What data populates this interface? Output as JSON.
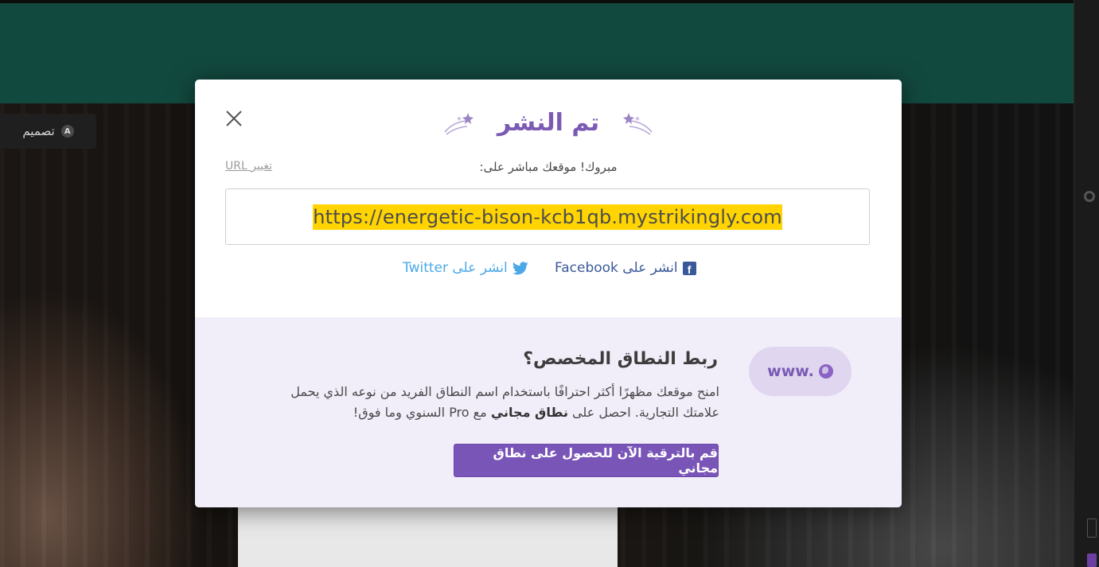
{
  "editor": {
    "design_label": "تصميم",
    "design_badge": "A"
  },
  "modal": {
    "title": "تم النشر",
    "subtitle": "مبروك! موقعك مباشر على:",
    "change_url_label": "تغيير URL",
    "site_url": "https://energetic-bison-kcb1qb.mystrikingly.com",
    "share_facebook": "انشر على Facebook",
    "share_twitter": "انشر على Twitter"
  },
  "promo": {
    "www_label": "www.",
    "title": "ربط النطاق المخصص؟",
    "desc_part1": "امنح موقعك مظهرًا أكثر احترافًا باستخدام اسم النطاق الفريد من نوعه الذي يحمل علامتك التجارية. احصل على ",
    "desc_bold": "نطاق مجاني",
    "desc_part2": " مع Pro السنوي وما فوق!",
    "upgrade_button": "قم بالترقية الآن للحصول على نطاق مجاني"
  },
  "colors": {
    "accent": "#7b5ab4",
    "url_highlight": "#ffd400",
    "facebook": "#3b5998",
    "twitter": "#4aa8e8",
    "teal_header": "#12493f",
    "promo_bg": "#f1edf9"
  }
}
